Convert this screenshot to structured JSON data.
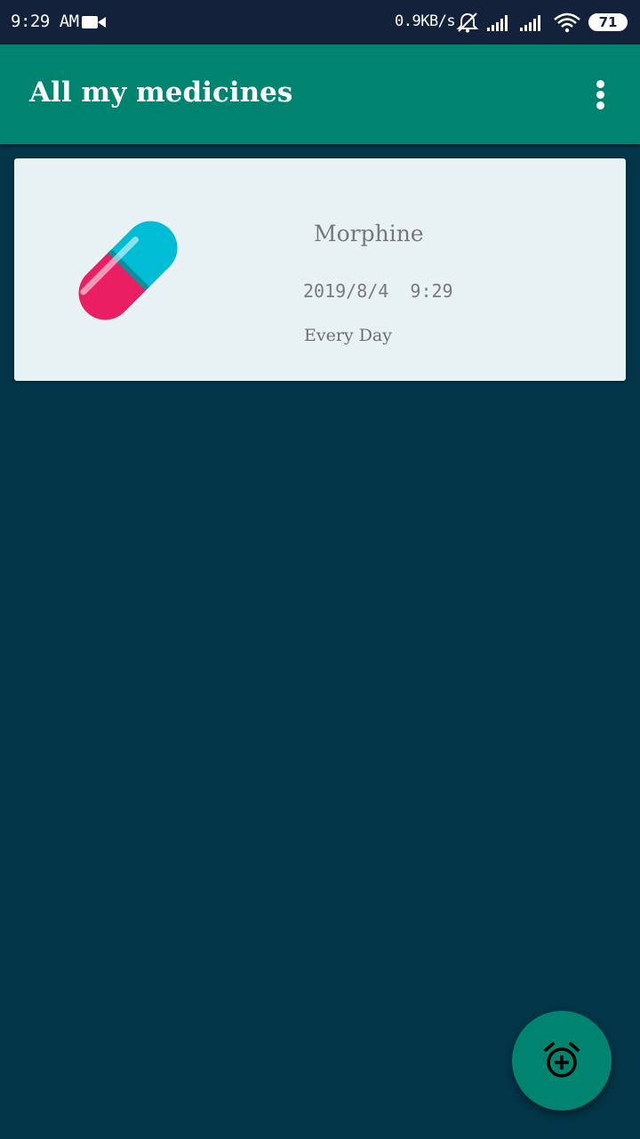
{
  "status_bar": {
    "time": "9:29 AM",
    "speed": "0.9KB/s",
    "battery": "71",
    "icons": [
      "video-camera-icon",
      "muted-bell-icon",
      "signal-icon",
      "signal-icon",
      "wifi-icon",
      "battery-icon"
    ]
  },
  "app_bar": {
    "title": "All my medicines",
    "menu_icon": "more-vertical-icon",
    "background_color": "#00836f"
  },
  "medicines": [
    {
      "name": "Morphine",
      "datetime": "2019/8/4  9:29",
      "frequency": "Every Day",
      "icon": "capsule-icon"
    }
  ],
  "fab": {
    "icon": "add-alarm-icon"
  },
  "colors": {
    "background": "#023548",
    "status_bar": "#13213a",
    "card": "#e8f1f4",
    "accent": "#00836f",
    "capsule_top": "#00bcd4",
    "capsule_bottom": "#e91e63"
  }
}
